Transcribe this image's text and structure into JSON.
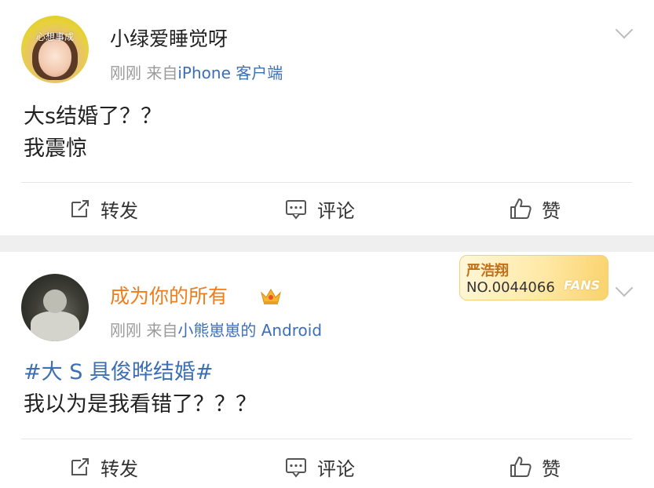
{
  "posts": [
    {
      "avatar_text": "心想事成",
      "username": "小绿爱睡觉呀",
      "time": "刚刚",
      "from_label": "来自",
      "source": "iPhone 客户端",
      "content_lines": [
        "大s结婚了？？",
        "我震惊"
      ],
      "actions": {
        "repost": "转发",
        "comment": "评论",
        "like": "赞"
      }
    },
    {
      "username": "成为你的所有",
      "time": "刚刚",
      "from_label": "来自",
      "source": "小熊崽崽的 Android",
      "fans_badge": {
        "name": "严浩翔",
        "number": "NO.0044066",
        "word": "FANS"
      },
      "topic": "#大 S 具俊晔结婚#",
      "content_line": "我以为是我看错了？？？",
      "actions": {
        "repost": "转发",
        "comment": "评论",
        "like": "赞"
      }
    }
  ],
  "colors": {
    "link": "#3d6fb5",
    "vip_name": "#f07d1c",
    "meta": "#9a9a9a",
    "separator": "#efefef"
  },
  "icons": [
    "repost-icon",
    "comment-icon",
    "like-icon",
    "chevron-down-icon",
    "crown-icon"
  ]
}
